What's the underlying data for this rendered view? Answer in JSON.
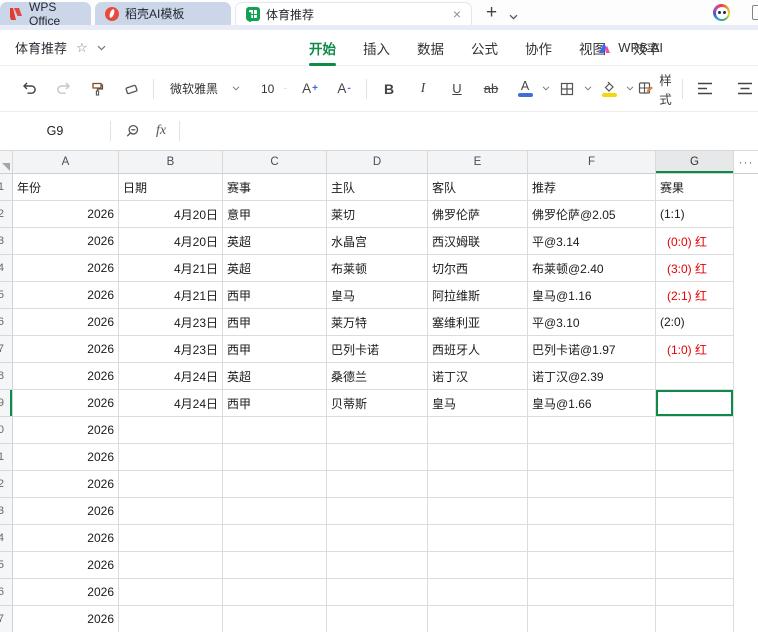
{
  "tabbar": {
    "tabs": [
      {
        "label": "WPS Office",
        "active": false
      },
      {
        "label": "稻壳AI模板",
        "active": false
      },
      {
        "label": "体育推荐",
        "active": true
      }
    ],
    "close_label": "×",
    "new_tab_label": "+"
  },
  "menubar": {
    "doc_title": "体育推荐",
    "star": "☆",
    "items": [
      {
        "label": "开始",
        "active": true
      },
      {
        "label": "插入",
        "active": false
      },
      {
        "label": "数据",
        "active": false
      },
      {
        "label": "公式",
        "active": false
      },
      {
        "label": "协作",
        "active": false
      },
      {
        "label": "视图",
        "active": false
      },
      {
        "label": "效率",
        "active": false
      }
    ],
    "wps_ai_label": "WPS AI"
  },
  "toolbar": {
    "font_name": "微软雅黑",
    "font_size": "10",
    "grow_font_label": "A",
    "grow_font_sign": "+",
    "shrink_font_label": "A",
    "shrink_font_sign": "-",
    "bold_label": "B",
    "italic_label": "I",
    "underline_label": "U",
    "strikethrough_label": "ab",
    "font_color_label": "A",
    "style_label": "样式"
  },
  "formula_bar": {
    "cell_ref": "G9",
    "fx_label": "fx"
  },
  "sheet": {
    "column_headers": [
      "A",
      "B",
      "C",
      "D",
      "E",
      "F",
      "G"
    ],
    "more_columns_label": "···",
    "selected_column": "G",
    "selected_cell_ref": "G9",
    "field_headers": [
      "年份",
      "日期",
      "赛事",
      "主队",
      "客队",
      "推荐",
      "赛果"
    ],
    "rows": [
      {
        "n": 2,
        "cells": [
          "2026",
          "4月20日",
          "意甲",
          "莱切",
          "佛罗伦萨",
          "佛罗伦萨@2.05",
          "(1:1)"
        ],
        "red": false,
        "selected": false
      },
      {
        "n": 3,
        "cells": [
          "2026",
          "4月20日",
          "英超",
          "水晶宫",
          "西汉姆联",
          "平@3.14",
          "(0:0) 红"
        ],
        "red": true,
        "selected": false
      },
      {
        "n": 4,
        "cells": [
          "2026",
          "4月21日",
          "英超",
          "布莱顿",
          "切尔西",
          "布莱顿@2.40",
          "(3:0) 红"
        ],
        "red": true,
        "selected": false
      },
      {
        "n": 5,
        "cells": [
          "2026",
          "4月21日",
          "西甲",
          "皇马",
          "阿拉维斯",
          "皇马@1.16",
          "(2:1) 红"
        ],
        "red": true,
        "selected": false
      },
      {
        "n": 6,
        "cells": [
          "2026",
          "4月23日",
          "西甲",
          "莱万特",
          "塞维利亚",
          "平@3.10",
          "(2:0)"
        ],
        "red": false,
        "selected": false
      },
      {
        "n": 7,
        "cells": [
          "2026",
          "4月23日",
          "西甲",
          "巴列卡诺",
          "西班牙人",
          "巴列卡诺@1.97",
          "(1:0) 红"
        ],
        "red": true,
        "selected": false
      },
      {
        "n": 8,
        "cells": [
          "2026",
          "4月24日",
          "英超",
          "桑德兰",
          "诺丁汉",
          "诺丁汉@2.39",
          ""
        ],
        "red": false,
        "selected": false
      },
      {
        "n": 9,
        "cells": [
          "2026",
          "4月24日",
          "西甲",
          "贝蒂斯",
          "皇马",
          "皇马@1.66",
          ""
        ],
        "red": false,
        "selected": true
      },
      {
        "n": 10,
        "cells": [
          "2026",
          "",
          "",
          "",
          "",
          "",
          ""
        ],
        "red": false,
        "selected": false
      },
      {
        "n": 11,
        "cells": [
          "2026",
          "",
          "",
          "",
          "",
          "",
          ""
        ],
        "red": false,
        "selected": false
      },
      {
        "n": 12,
        "cells": [
          "2026",
          "",
          "",
          "",
          "",
          "",
          ""
        ],
        "red": false,
        "selected": false
      },
      {
        "n": 13,
        "cells": [
          "2026",
          "",
          "",
          "",
          "",
          "",
          ""
        ],
        "red": false,
        "selected": false
      },
      {
        "n": 14,
        "cells": [
          "2026",
          "",
          "",
          "",
          "",
          "",
          ""
        ],
        "red": false,
        "selected": false
      },
      {
        "n": 15,
        "cells": [
          "2026",
          "",
          "",
          "",
          "",
          "",
          ""
        ],
        "red": false,
        "selected": false
      },
      {
        "n": 16,
        "cells": [
          "2026",
          "",
          "",
          "",
          "",
          "",
          ""
        ],
        "red": false,
        "selected": false
      },
      {
        "n": 17,
        "cells": [
          "2026",
          "",
          "",
          "",
          "",
          "",
          ""
        ],
        "red": false,
        "selected": false
      }
    ],
    "colors": {
      "accent_green": "#0e8b46",
      "result_red": "#e60000",
      "tab_inactive": "#ccd6e9",
      "font_color_swatch": "#3f6fd6",
      "fill_color_swatch": "#f3d60b"
    }
  }
}
